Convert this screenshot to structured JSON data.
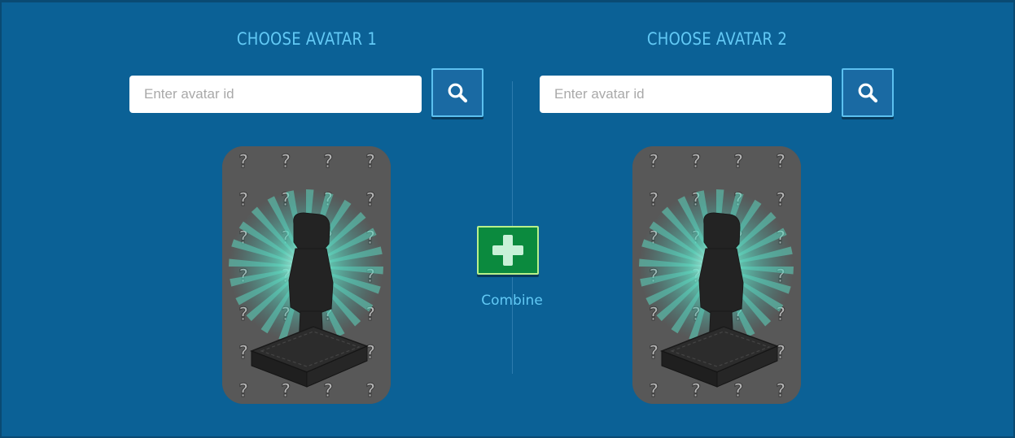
{
  "avatar1": {
    "title": "CHOOSE AVATAR 1",
    "search_placeholder": "Enter avatar id",
    "search_value": "",
    "search_icon": "search-icon"
  },
  "avatar2": {
    "title": "CHOOSE AVATAR 2",
    "search_placeholder": "Enter avatar id",
    "search_value": "",
    "search_icon": "search-icon"
  },
  "combine": {
    "label": "Combine",
    "icon": "plus-icon"
  },
  "colors": {
    "background": "#0b6196",
    "title": "#62c9f5",
    "search_button": "#1a6aa3",
    "combine_button": "#0b8a3e",
    "card": "#575757"
  }
}
